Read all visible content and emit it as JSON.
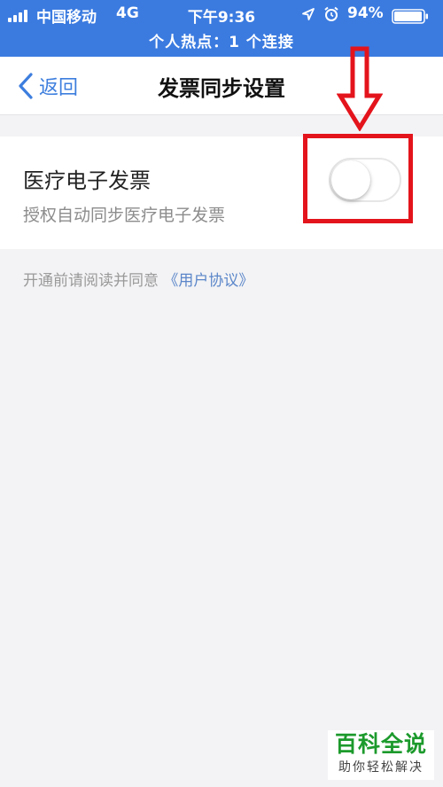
{
  "status_bar": {
    "carrier": "中国移动",
    "network": "4G",
    "time": "下午9:36",
    "battery": "94%",
    "hotspot": "个人热点：1 个连接",
    "background_color": "#3b7be0"
  },
  "nav": {
    "back_label": "返回",
    "title": "发票同步设置"
  },
  "setting": {
    "title": "医疗电子发票",
    "subtitle": "授权自动同步医疗电子发票",
    "enabled": false
  },
  "agreement": {
    "prefix": "开通前请阅读并同意",
    "link": "《用户协议》",
    "link_color": "#5b86c9"
  },
  "annotation": {
    "color": "#e4141c"
  },
  "watermark": {
    "title": "百科全说",
    "subtitle": "助你轻松解决",
    "color": "#1c9a2c"
  }
}
